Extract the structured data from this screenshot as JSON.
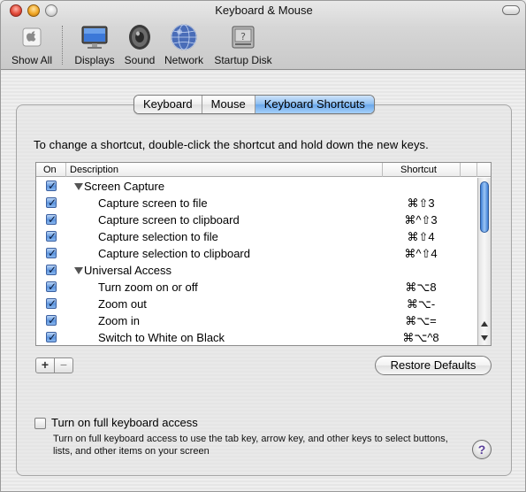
{
  "window": {
    "title": "Keyboard & Mouse"
  },
  "toolbar": {
    "items": [
      {
        "label": "Show All",
        "icon": "apple-icon"
      },
      {
        "label": "Displays",
        "icon": "display-icon"
      },
      {
        "label": "Sound",
        "icon": "speaker-icon"
      },
      {
        "label": "Network",
        "icon": "globe-icon"
      },
      {
        "label": "Startup Disk",
        "icon": "hard-disk-icon"
      }
    ]
  },
  "tabs": [
    {
      "label": "Keyboard",
      "active": false
    },
    {
      "label": "Mouse",
      "active": false
    },
    {
      "label": "Keyboard Shortcuts",
      "active": true
    }
  ],
  "hint": "To change a shortcut, double-click the shortcut and hold down the new keys.",
  "table": {
    "headers": {
      "on": "On",
      "description": "Description",
      "shortcut": "Shortcut"
    },
    "rows": [
      {
        "type": "group",
        "on": true,
        "description": "Screen Capture",
        "shortcut": ""
      },
      {
        "type": "item",
        "on": true,
        "description": "Capture screen to file",
        "shortcut": "⌘⇧3"
      },
      {
        "type": "item",
        "on": true,
        "description": "Capture screen to clipboard",
        "shortcut": "⌘^⇧3"
      },
      {
        "type": "item",
        "on": true,
        "description": "Capture selection to file",
        "shortcut": "⌘⇧4"
      },
      {
        "type": "item",
        "on": true,
        "description": "Capture selection to clipboard",
        "shortcut": "⌘^⇧4"
      },
      {
        "type": "group",
        "on": true,
        "description": "Universal Access",
        "shortcut": ""
      },
      {
        "type": "item",
        "on": true,
        "description": "Turn zoom on or off",
        "shortcut": "⌘⌥8"
      },
      {
        "type": "item",
        "on": true,
        "description": "Zoom out",
        "shortcut": "⌘⌥-"
      },
      {
        "type": "item",
        "on": true,
        "description": "Zoom in",
        "shortcut": "⌘⌥="
      },
      {
        "type": "item",
        "on": true,
        "description": "Switch to White on Black",
        "shortcut": "⌘⌥^8"
      }
    ]
  },
  "buttons": {
    "add": "+",
    "remove": "−",
    "restore": "Restore Defaults",
    "help": "?"
  },
  "keyboard_access": {
    "label": "Turn on full keyboard access",
    "checked": false,
    "description": "Turn on full keyboard access to use the tab key, arrow key, and other keys to select buttons, lists, and other items on your screen"
  }
}
